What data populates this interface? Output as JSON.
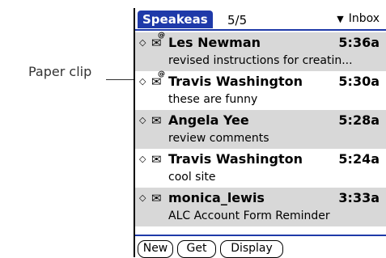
{
  "callout": {
    "label": "Paper clip"
  },
  "header": {
    "app_name": "Speakeas",
    "count": "5/5",
    "folder": "Inbox"
  },
  "messages": [
    {
      "sender": "Les Newman",
      "time": "5:36a",
      "subject": "revised instructions for creatin...",
      "has_attachment": true
    },
    {
      "sender": "Travis Washington",
      "time": "5:30a",
      "subject": "these are funny",
      "has_attachment": true
    },
    {
      "sender": "Angela Yee",
      "time": "5:28a",
      "subject": "review comments",
      "has_attachment": false
    },
    {
      "sender": "Travis Washington",
      "time": "5:24a",
      "subject": "cool site",
      "has_attachment": false
    },
    {
      "sender": "monica_lewis",
      "time": "3:33a",
      "subject": "ALC Account Form Reminder",
      "has_attachment": false
    }
  ],
  "buttons": {
    "new": "New",
    "get": "Get",
    "display": "Display"
  },
  "colors": {
    "accent": "#1f3aa9",
    "row_shade": "#d8d8d8"
  }
}
